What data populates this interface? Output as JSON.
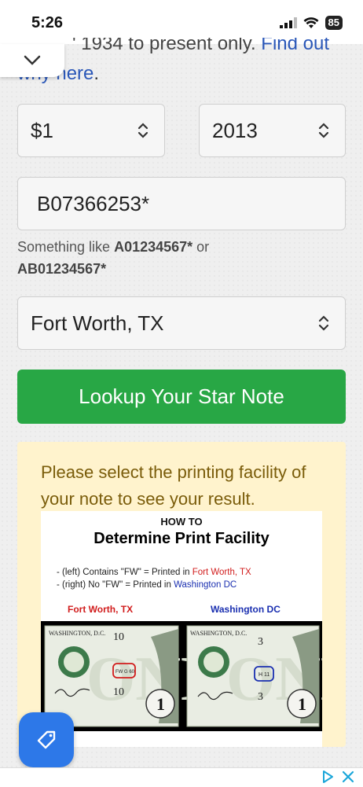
{
  "status_bar": {
    "time": "5:26",
    "battery": "85"
  },
  "top_text": {
    "line1_prefix": "' 1934 to present only. ",
    "line1_link": "Find out",
    "line2_link": "why here",
    "line2_suffix": "."
  },
  "form": {
    "denomination": "$1",
    "year": "2013",
    "serial_value": "B07366253*",
    "hint_prefix": "Something like ",
    "hint_example1": "A01234567*",
    "hint_or": " or",
    "hint_example2": "AB01234567*",
    "facility": "Fort Worth, TX",
    "lookup_label": "Lookup Your Star Note"
  },
  "notice": {
    "message": "Please select the printing facility of your note to see your result.",
    "graphic": {
      "how_to": "HOW TO",
      "title": "Determine Print Facility",
      "line1_prefix": "- (left) Contains \"FW\" = Printed in ",
      "line1_place": "Fort Worth, TX",
      "line2_prefix": "- (right) No \"FW\" = Printed in ",
      "line2_place": "Washington DC",
      "label_left": "Fort Worth, TX",
      "label_right": "Washington DC",
      "note_left_city": "WASHINGTON, D.C.",
      "note_right_city": "WASHINGTON, D.C.",
      "note_left_num": "10",
      "note_right_num": "3",
      "note_left_plate": "FW G 60",
      "note_right_plate": "H 11"
    }
  },
  "colors": {
    "green_button": "#28a745",
    "notice_bg": "#fff3cd",
    "notice_text": "#7a5c0a",
    "tag_button": "#2d78e8"
  }
}
